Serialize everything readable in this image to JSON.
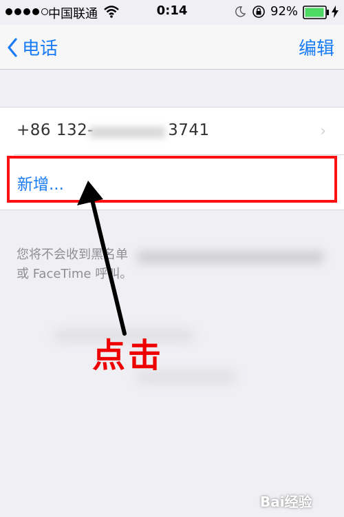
{
  "status_bar": {
    "carrier": "中国联通",
    "time": "0:14",
    "battery_percent": "92%",
    "icons": [
      "signal-dots-icon",
      "wifi-icon",
      "moon-icon",
      "rotation-lock-icon",
      "battery-icon",
      "charging-bolt-icon"
    ]
  },
  "nav": {
    "back_label": "电话",
    "edit_label": "编辑"
  },
  "list": {
    "phone_number": "+86 132-",
    "phone_number_tail": "3741",
    "add_label": "新增..."
  },
  "footer_note": "您将不会收到黑名单",
  "footer_note_line2": "或 FaceTime 呼叫。",
  "annotation": {
    "text": "点击",
    "color": "#ee0000"
  },
  "watermark": "Bai经验",
  "colors": {
    "accent": "#1a7cf5",
    "highlight_border": "#ff1010",
    "battery_fill": "#4cd964"
  }
}
